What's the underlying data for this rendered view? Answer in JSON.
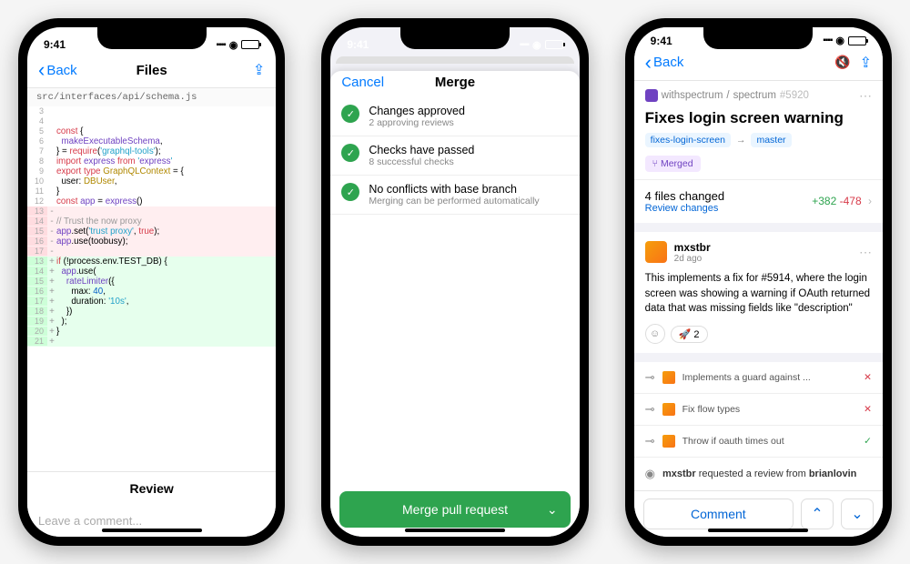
{
  "status": {
    "time": "9:41"
  },
  "files": {
    "back": "Back",
    "title": "Files",
    "breadcrumb": "src/interfaces/api/schema.js",
    "review_tab": "Review",
    "comment_ph": "Leave a comment...",
    "lines": [
      {
        "n": "3",
        "s": " ",
        "t": "",
        "cls": ""
      },
      {
        "n": "4",
        "s": " ",
        "t": "",
        "cls": ""
      },
      {
        "n": "5",
        "s": " ",
        "t": "const {",
        "cls": ""
      },
      {
        "n": "6",
        "s": " ",
        "t": "  makeExecutableSchema,",
        "cls": ""
      },
      {
        "n": "7",
        "s": " ",
        "t": "} = require('graphql-tools');",
        "cls": ""
      },
      {
        "n": "8",
        "s": " ",
        "t": "import express from 'express'",
        "cls": ""
      },
      {
        "n": "9",
        "s": " ",
        "t": "export type GraphQLContext = {",
        "cls": ""
      },
      {
        "n": "10",
        "s": " ",
        "t": "  user: DBUser,",
        "cls": ""
      },
      {
        "n": "11",
        "s": " ",
        "t": "}",
        "cls": ""
      },
      {
        "n": "12",
        "s": " ",
        "t": "const app = express()",
        "cls": ""
      },
      {
        "n": "13",
        "s": "-",
        "t": "",
        "cls": "del"
      },
      {
        "n": "14",
        "s": "-",
        "t": "// Trust the now proxy",
        "cls": "del"
      },
      {
        "n": "15",
        "s": "-",
        "t": "app.set('trust proxy', true);",
        "cls": "del"
      },
      {
        "n": "16",
        "s": "-",
        "t": "app.use(toobusy);",
        "cls": "del"
      },
      {
        "n": "17",
        "s": "-",
        "t": "",
        "cls": "del"
      },
      {
        "n": "13",
        "s": "+",
        "t": "if (!process.env.TEST_DB) {",
        "cls": "add"
      },
      {
        "n": "14",
        "s": "+",
        "t": "  app.use(",
        "cls": "add"
      },
      {
        "n": "15",
        "s": "+",
        "t": "    rateLimiter({",
        "cls": "add"
      },
      {
        "n": "16",
        "s": "+",
        "t": "      max: 40,",
        "cls": "add"
      },
      {
        "n": "17",
        "s": "+",
        "t": "      duration: '10s',",
        "cls": "add"
      },
      {
        "n": "18",
        "s": "+",
        "t": "    })",
        "cls": "add"
      },
      {
        "n": "19",
        "s": "+",
        "t": "  );",
        "cls": "add"
      },
      {
        "n": "20",
        "s": "+",
        "t": "}",
        "cls": "add"
      },
      {
        "n": "21",
        "s": "+",
        "t": "",
        "cls": "add"
      }
    ]
  },
  "merge": {
    "cancel": "Cancel",
    "title": "Merge",
    "checks": [
      {
        "title": "Changes approved",
        "sub": "2 approving reviews"
      },
      {
        "title": "Checks have passed",
        "sub": "8 successful checks"
      },
      {
        "title": "No conflicts with base branch",
        "sub": "Merging can be performed automatically"
      }
    ],
    "cta": "Merge pull request"
  },
  "pr": {
    "back": "Back",
    "repo_owner": "withspectrum",
    "repo_name": "spectrum",
    "number": "#5920",
    "title": "Fixes login screen warning",
    "branch_from": "fixes-login-screen",
    "branch_to": "master",
    "status": "Merged",
    "files_changed": "4 files changed",
    "review_link": "Review changes",
    "additions": "+382",
    "deletions": "-478",
    "author": "mxstbr",
    "ago": "2d ago",
    "body": "This implements a fix for #5914, where the login screen was showing a warning if OAuth returned data that was missing fields like \"description\"",
    "reaction": {
      "emoji": "🚀",
      "count": "2"
    },
    "commits": [
      {
        "msg": "Implements a guard against ...",
        "status": "x"
      },
      {
        "msg": "Fix flow types",
        "status": "x"
      },
      {
        "msg": "Throw if oauth times out",
        "status": "check"
      }
    ],
    "event_user": "mxstbr",
    "event_text_mid": " requested a review from ",
    "event_target": "brianlovin",
    "comment_btn": "Comment"
  }
}
